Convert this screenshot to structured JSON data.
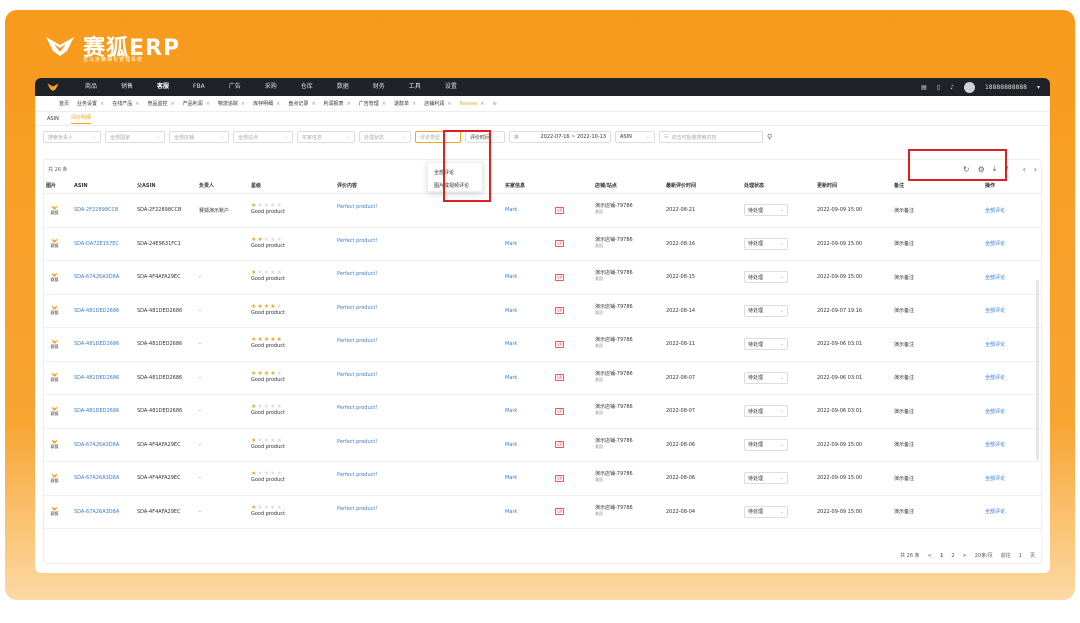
{
  "brand": {
    "title": "赛狐ERP",
    "subtitle": "亚马逊精细化管理系统",
    "accent": "#f5a623"
  },
  "topnav": {
    "items": [
      "商品",
      "销售",
      "客服",
      "FBA",
      "广告",
      "采购",
      "仓库",
      "数据",
      "财务",
      "工具",
      "设置"
    ],
    "active": 2,
    "user": "18888888888"
  },
  "tabs": [
    {
      "label": "首页"
    },
    {
      "label": "业务设置"
    },
    {
      "label": "在线产品"
    },
    {
      "label": "竞品监控"
    },
    {
      "label": "产品利润"
    },
    {
      "label": "物流追踪"
    },
    {
      "label": "库存明细"
    },
    {
      "label": "盘点记录"
    },
    {
      "label": "利润报表"
    },
    {
      "label": "广告管理"
    },
    {
      "label": "退款单"
    },
    {
      "label": "店铺利润"
    },
    {
      "label": "Review",
      "active": true
    }
  ],
  "subtabs": {
    "items": [
      "ASIN",
      "评价明细"
    ],
    "active": 1
  },
  "filters": {
    "owner": "搜索负责人",
    "all_platform": "全部国家",
    "all_store": "全部店铺",
    "all_site": "全部站点",
    "buyer_info": "买家信息",
    "status": "处理状态",
    "review_type": "评论类型",
    "review_time": "评价时间",
    "date_range": "2022-07-16 ~ 2022-10-13",
    "asin": "ASIN",
    "search_placeholder": "双击可批量搜索内容"
  },
  "dropdown": {
    "options": [
      "全部评论",
      "图片或视频评论"
    ]
  },
  "table": {
    "count_label": "共 26 条",
    "headers": [
      "图片",
      "ASIN",
      "父ASIN",
      "负责人",
      "星级",
      "评价内容",
      "买家信息",
      "店铺/站点",
      "最新评价时间",
      "处理状态",
      "更新时间",
      "备注",
      "操作"
    ],
    "rows": [
      {
        "img": "赛狐",
        "asin": "SDA-2F22898CCB",
        "parent": "SDA-2F22898CCB",
        "owner": "赛狐演示账户",
        "stars": 1,
        "rating_label": "Good product",
        "content": "Perfect product!",
        "buyer": "Mark",
        "vp": "VP",
        "store": "演示店铺-79786",
        "site": "美国",
        "time": "2022-08-21",
        "status": "待处理",
        "updated": "2022-09-09 15:00",
        "note": "演示备注",
        "action": "全部评论"
      },
      {
        "img": "赛狐",
        "asin": "SDA-DA72E157EC",
        "parent": "SDA-24E9631FC1",
        "owner": "",
        "stars": 2,
        "rating_label": "Good product",
        "content": "Perfect product!",
        "buyer": "Mark",
        "vp": "VP",
        "store": "演示店铺-79786",
        "site": "美国",
        "time": "2022-08-16",
        "status": "待处理",
        "updated": "2022-09-09 15:00",
        "note": "演示备注",
        "action": "全部评论"
      },
      {
        "img": "赛狐",
        "asin": "SDA-67A26A3D8A",
        "parent": "SDA-4F4AFA29EC",
        "owner": "-",
        "stars": 1,
        "rating_label": "Good product",
        "content": "Perfect product!",
        "buyer": "Mark",
        "vp": "VP",
        "store": "演示店铺-79786",
        "site": "美国",
        "time": "2022-08-15",
        "status": "待处理",
        "updated": "2022-09-09 15:00",
        "note": "演示备注",
        "action": "全部评论"
      },
      {
        "img": "赛狐",
        "asin": "SDA-481DED2686",
        "parent": "SDA-481DED2686",
        "owner": "-",
        "stars": 4,
        "rating_label": "Good product",
        "content": "Perfect product!",
        "buyer": "Mark",
        "vp": "VP",
        "store": "演示店铺-79786",
        "site": "美国",
        "time": "2022-08-14",
        "status": "待处理",
        "updated": "2022-09-07 19:16",
        "note": "演示备注",
        "action": "全部评论"
      },
      {
        "img": "赛狐",
        "asin": "SDA-481DED2686",
        "parent": "SDA-481DED2686",
        "owner": "-",
        "stars": 5,
        "rating_label": "Good product",
        "content": "Perfect product!",
        "buyer": "Mark",
        "vp": "VP",
        "store": "演示店铺-79786",
        "site": "美国",
        "time": "2022-08-11",
        "status": "待处理",
        "updated": "2022-09-06 03:01",
        "note": "演示备注",
        "action": "全部评论"
      },
      {
        "img": "赛狐",
        "asin": "SDA-481DED2686",
        "parent": "SDA-481DED2686",
        "owner": "-",
        "stars": 4,
        "rating_label": "Good product",
        "content": "Perfect product!",
        "buyer": "Mark",
        "vp": "VP",
        "store": "演示店铺-79786",
        "site": "美国",
        "time": "2022-08-07",
        "status": "待处理",
        "updated": "2022-09-06 03:01",
        "note": "演示备注",
        "action": "全部评论"
      },
      {
        "img": "赛狐",
        "asin": "SDA-481DED2686",
        "parent": "SDA-481DED2686",
        "owner": "-",
        "stars": 1,
        "rating_label": "Good product",
        "content": "Perfect product!",
        "buyer": "Mark",
        "vp": "VP",
        "store": "演示店铺-79786",
        "site": "美国",
        "time": "2022-08-07",
        "status": "待处理",
        "updated": "2022-09-06 03:01",
        "note": "演示备注",
        "action": "全部评论"
      },
      {
        "img": "赛狐",
        "asin": "SDA-67A26A3D8A",
        "parent": "SDA-4F4AFA29EC",
        "owner": "-",
        "stars": 1,
        "rating_label": "Good product",
        "content": "Perfect product!",
        "buyer": "Mark",
        "vp": "VP",
        "store": "演示店铺-79786",
        "site": "美国",
        "time": "2022-08-06",
        "status": "待处理",
        "updated": "2022-09-09 15:00",
        "note": "演示备注",
        "action": "全部评论"
      },
      {
        "img": "赛狐",
        "asin": "SDA-67A26A3D8A",
        "parent": "SDA-4F4AFA29EC",
        "owner": "-",
        "stars": 1,
        "rating_label": "Good product",
        "content": "Perfect product!",
        "buyer": "Mark",
        "vp": "VP",
        "store": "演示店铺-79786",
        "site": "美国",
        "time": "2022-08-06",
        "status": "待处理",
        "updated": "2022-09-09 15:00",
        "note": "演示备注",
        "action": "全部评论"
      },
      {
        "img": "赛狐",
        "asin": "SDA-67A26A3D8A",
        "parent": "SDA-4F4AFA29EC",
        "owner": "-",
        "stars": 1,
        "rating_label": "Good product",
        "content": "Perfect product!",
        "buyer": "Mark",
        "vp": "VP",
        "store": "演示店铺-79786",
        "site": "美国",
        "time": "2022-08-04",
        "status": "待处理",
        "updated": "2022-09-09 15:00",
        "note": "演示备注",
        "action": "全部评论"
      }
    ]
  },
  "pager": {
    "total": "共 26 条",
    "prev": "<",
    "pages": [
      "1",
      "2"
    ],
    "next": ">",
    "size": "20条/页",
    "goto": "前往",
    "page_input": "1",
    "page_unit": "页"
  },
  "colors": {
    "highlight": "#e02020",
    "link": "#3a7bd5"
  }
}
